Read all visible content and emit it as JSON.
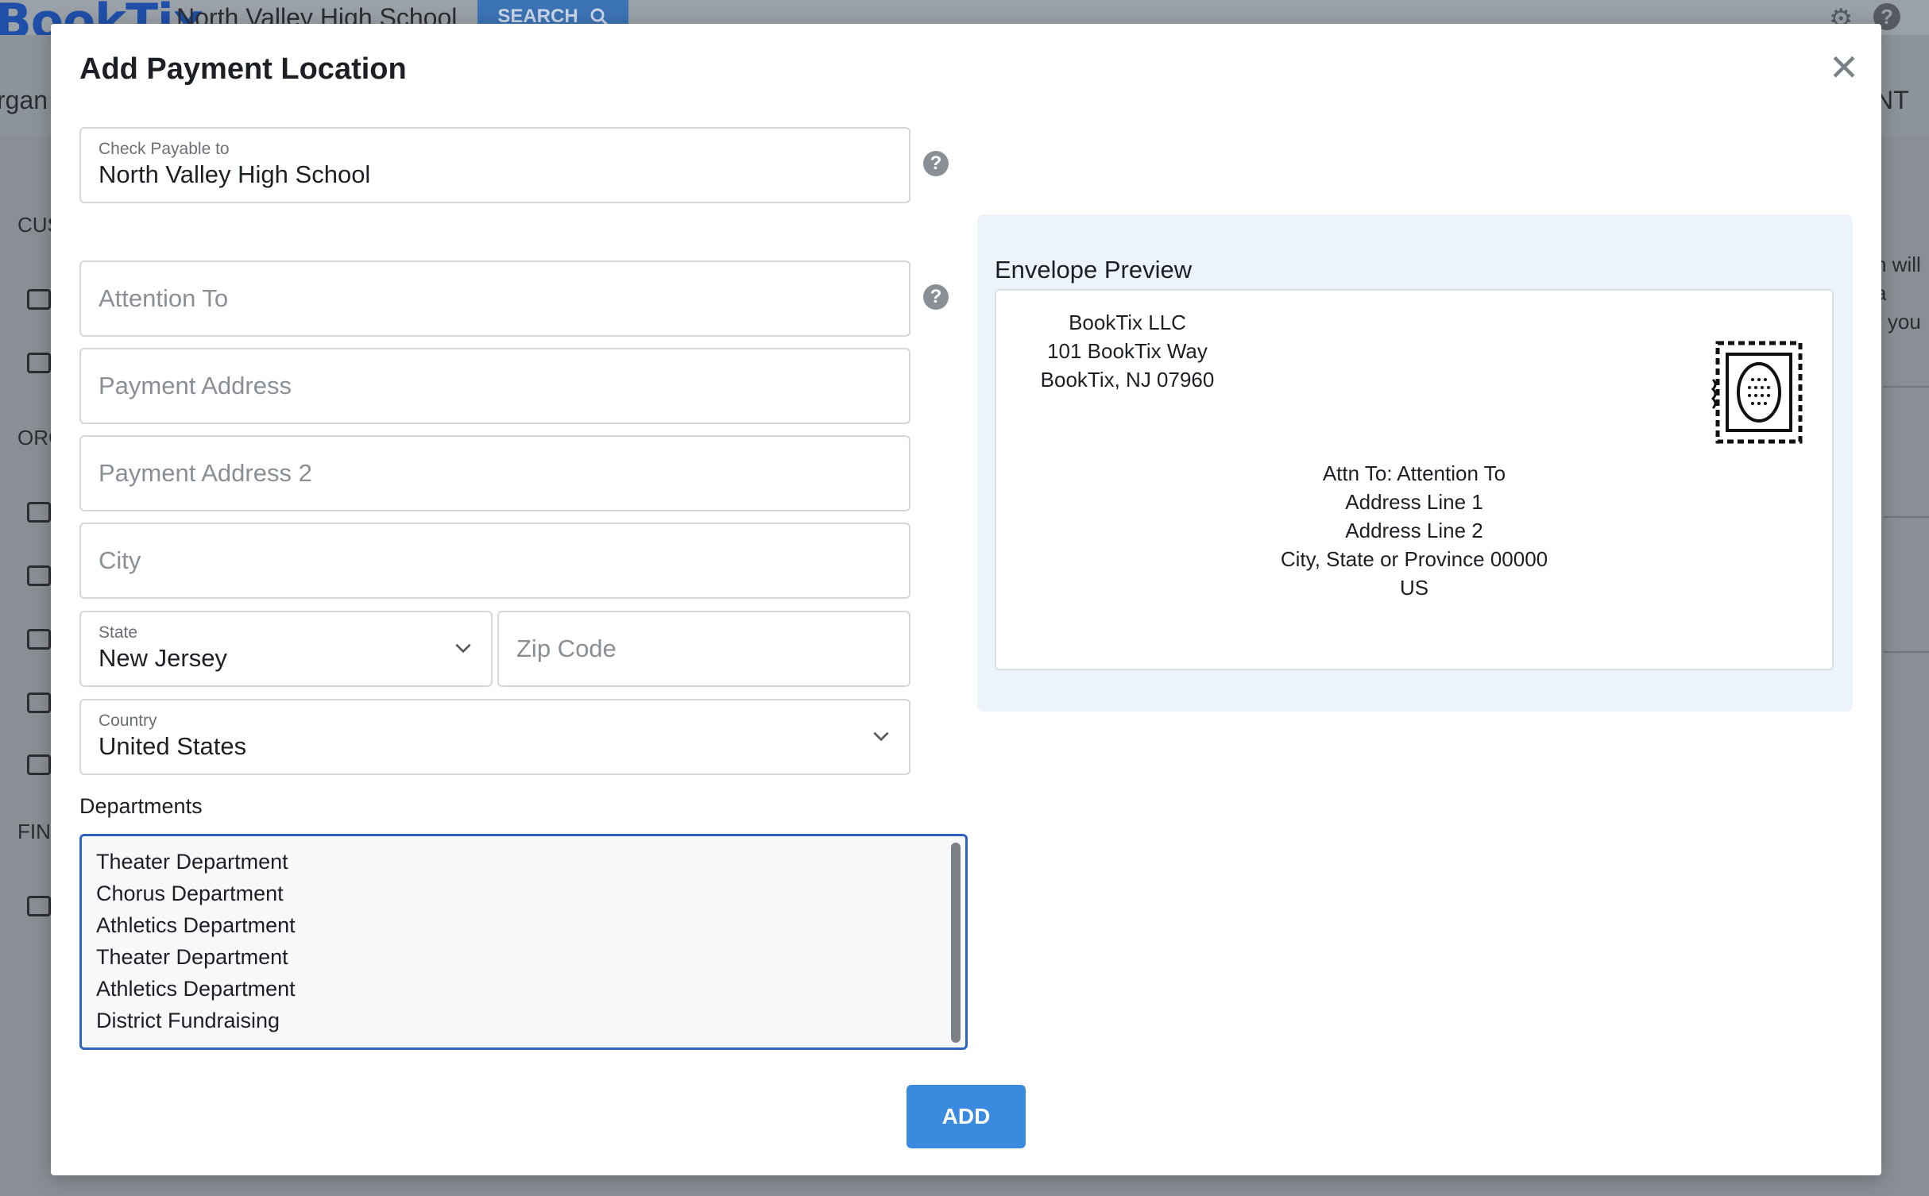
{
  "background": {
    "logo": "BookTix",
    "school_name": "North Valley High School",
    "search_label": "SEARCH",
    "nav_left": "rgan",
    "nav_right": "NT",
    "sidebar_labels": [
      "CUS",
      "ORG",
      "FIN"
    ],
    "right_text": [
      "h will",
      "a",
      "r you"
    ]
  },
  "modal": {
    "title": "Add Payment Location",
    "close_glyph": "✕"
  },
  "form": {
    "check_payable": {
      "label": "Check Payable to",
      "value": "North Valley High School"
    },
    "attention_to": {
      "placeholder": "Attention To"
    },
    "payment_address": {
      "placeholder": "Payment Address"
    },
    "payment_address_2": {
      "placeholder": "Payment Address 2"
    },
    "city": {
      "placeholder": "City"
    },
    "state": {
      "label": "State",
      "value": "New Jersey"
    },
    "zip": {
      "placeholder": "Zip Code"
    },
    "country": {
      "label": "Country",
      "value": "United States"
    },
    "help_glyph": "?",
    "departments_label": "Departments",
    "departments": [
      "Theater Department",
      "Chorus Department",
      "Athletics Department",
      "Theater Department",
      "Athletics Department",
      "District Fundraising"
    ],
    "add_label": "ADD"
  },
  "preview": {
    "title": "Envelope Preview",
    "return_address": [
      "BookTix LLC",
      "101 BookTix Way",
      "BookTix, NJ 07960"
    ],
    "recipient": [
      "Attn To: Attention To",
      "Address Line 1",
      "Address Line 2",
      "City, State or Province 00000",
      "US"
    ]
  },
  "colors": {
    "accent": "#3a8be0",
    "focus_border": "#2f63c1",
    "preview_bg": "#edf3fb"
  }
}
